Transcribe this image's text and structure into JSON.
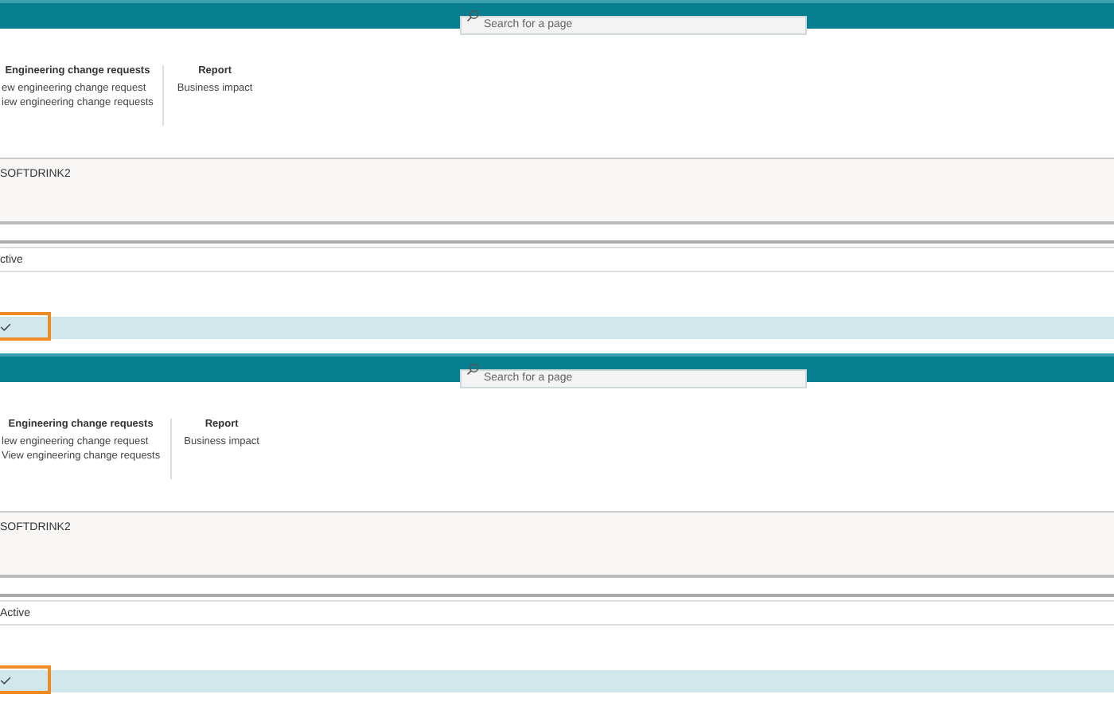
{
  "panels": [
    {
      "search": {
        "placeholder": "Search for a page"
      },
      "action_groups": [
        {
          "heading": "Engineering change requests",
          "items": [
            "ew engineering change request",
            "iew engineering change requests"
          ]
        },
        {
          "heading": "Report",
          "items": [
            "Business impact"
          ]
        }
      ],
      "record": "SOFTDRINK2",
      "status": "ctive",
      "row": {
        "selected": true,
        "checked": true
      }
    },
    {
      "search": {
        "placeholder": "Search for a page"
      },
      "action_groups": [
        {
          "heading": "Engineering change requests",
          "items": [
            "lew engineering change request",
            "View engineering change requests"
          ]
        },
        {
          "heading": "Report",
          "items": [
            "Business impact"
          ]
        }
      ],
      "record": "SOFTDRINK2",
      "status": "Active",
      "row": {
        "selected": true,
        "checked": true
      }
    }
  ]
}
